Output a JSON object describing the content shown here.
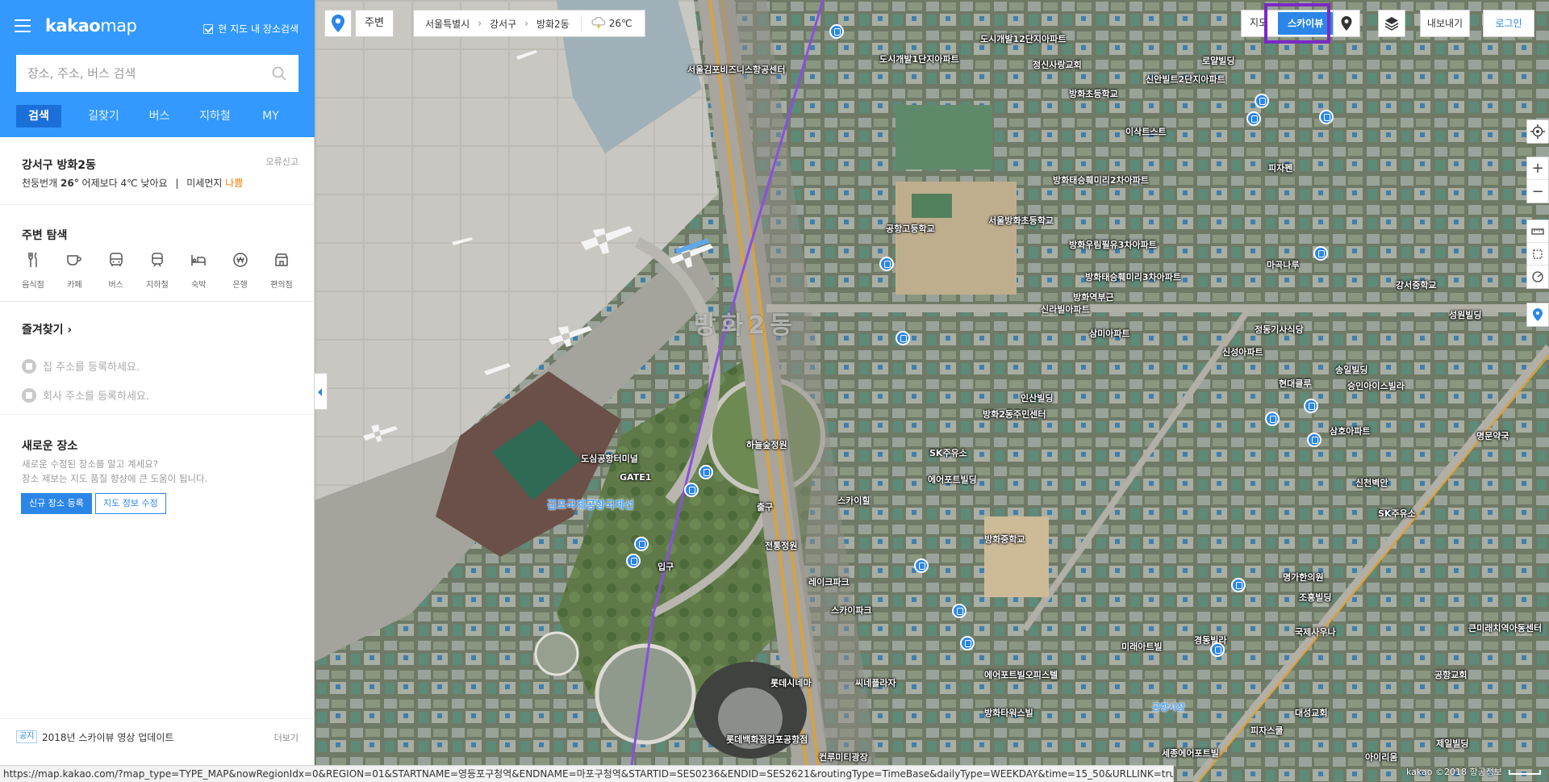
{
  "app": {
    "logo_bold": "kakao",
    "logo_rest": "map",
    "in_map_search_label": "현 지도 내 장소검색"
  },
  "search": {
    "placeholder": "장소, 주소, 버스 검색"
  },
  "tabs": [
    "검색",
    "길찾기",
    "버스",
    "지하철",
    "MY"
  ],
  "region": {
    "name": "강서구 방화2동",
    "report_label": "오류신고",
    "weather_prefix": "천둥번개",
    "temperature": "26°",
    "compare": "어제보다 4℃ 낮아요",
    "dust_label": "미세먼지",
    "dust_value": "나쁨"
  },
  "explore": {
    "title": "주변 탐색",
    "categories": [
      {
        "label": "음식점",
        "icon": "restaurant-icon"
      },
      {
        "label": "카페",
        "icon": "cafe-icon"
      },
      {
        "label": "버스",
        "icon": "bus-icon"
      },
      {
        "label": "지하철",
        "icon": "subway-icon"
      },
      {
        "label": "숙박",
        "icon": "hotel-icon"
      },
      {
        "label": "은행",
        "icon": "bank-icon"
      },
      {
        "label": "편의점",
        "icon": "store-icon"
      }
    ]
  },
  "favorites": {
    "title": "즐겨찾기 ›",
    "home": "집 주소를 등록하세요.",
    "work": "회사 주소를 등록하세요."
  },
  "new_place": {
    "title": "새로운 장소",
    "desc1": "새로운 수정된 장소를 알고 계세요?",
    "desc2": "장소 제보는 지도 품질 향상에 큰 도움이 됩니다.",
    "register_button": "신규 장소 등록",
    "edit_button": "지도 정보 수정"
  },
  "notice": {
    "tag": "공지",
    "text": "2018년 스카이뷰 영상 업데이트",
    "more": "더보기"
  },
  "map": {
    "nearby_button": "주변",
    "breadcrumb": [
      "서울특별시",
      "강서구",
      "방화2동"
    ],
    "weather_temp": "26℃",
    "map_types": [
      "지도",
      "스카이뷰"
    ],
    "selected_map_type": "스카이뷰",
    "export_button": "내보내기",
    "login_button": "로그인",
    "copyright": "kakao ©2018 항공정보",
    "district_label": "방화2동",
    "pois": [
      "서울김포비즈니스항공센터",
      "도시개발1단지아파트",
      "정신사랑교회",
      "도시개발12단지아파트",
      "신안빌트2단지아파트",
      "이삭트스트",
      "방화초등학교",
      "공항고등학교",
      "서울방화초등학교",
      "방화태승훼미리2차아파트",
      "방화우림필유3차아파트",
      "방화태승훼미리3차아파트",
      "신라빌아파트",
      "삼미아파트",
      "정동기사식당",
      "신성아파트",
      "인산빌딩",
      "방화2동주민센터",
      "하늘숲정원",
      "도심공항터미널",
      "김포국제공항국제선",
      "GATE1",
      "출구",
      "스카이힐",
      "전통정원",
      "레이크파크",
      "스카이파크",
      "입구",
      "SK주유소",
      "에어포트빌딩",
      "방화중학교",
      "롯데시네마",
      "롯데백화점김포공항점",
      "씨네플라자",
      "컨루미티광장",
      "공항시장",
      "경동빌라",
      "에어포트빌오피스텔",
      "방화타워스빌",
      "미래아트빌",
      "명가한의원",
      "조흥빌딩",
      "국제사우나",
      "세종에어포트빌",
      "대성교회",
      "피자스쿨",
      "아이리움",
      "명문약국",
      "SK주유소",
      "현대클루",
      "송일빌딩",
      "승인아이스빌라",
      "삼호아파트",
      "강서중학교",
      "로얄빌딩",
      "성원빌딩",
      "큰미래치역아동센터",
      "공항교회",
      "제일빌딩",
      "방화역부근",
      "마곡나루",
      "피자펜",
      "신천벽안"
    ]
  },
  "status_bar": "https://map.kakao.com/?map_type=TYPE_MAP&nowRegionIdx=0&REGION=01&STARTNAME=영등포구청역&ENDNAME=마포구청역&STARTID=SES0236&ENDID=SES2621&routingType=TimeBase&dailyType=WEEKDAY&time=15_50&URLLINK=true&target=subway#",
  "colors": {
    "brand_blue": "#3399ff",
    "tab_active": "#1a6fd8",
    "highlight": "#7b28c8",
    "dust_bad": "#f07b00"
  }
}
